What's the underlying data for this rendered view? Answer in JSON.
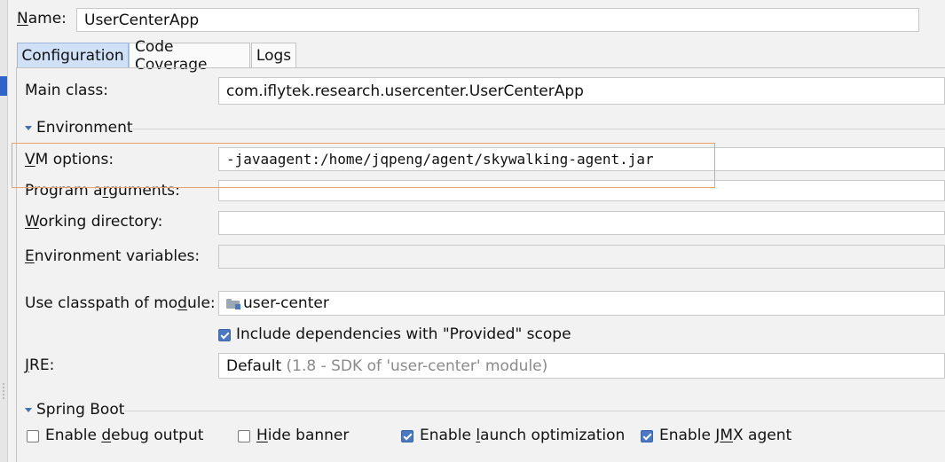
{
  "name": {
    "label_before": "",
    "label_ul": "N",
    "label_after": "ame:",
    "value": "UserCenterApp"
  },
  "tabs": [
    {
      "label": "Configuration",
      "active": true
    },
    {
      "label": "Code Coverage",
      "active": false
    },
    {
      "label": "Logs",
      "active": false
    }
  ],
  "main_class": {
    "label": "Main class:",
    "value": "com.iflytek.research.usercenter.UserCenterApp"
  },
  "environment": {
    "title": "Environment"
  },
  "vm_options": {
    "label_ul": "V",
    "label_after": "M options:",
    "value": "-javaagent:/home/jqpeng/agent/skywalking-agent.jar"
  },
  "program_arguments": {
    "label_before": "Program a",
    "label_ul": "r",
    "label_after": "guments:",
    "value": ""
  },
  "working_directory": {
    "label_ul": "W",
    "label_after": "orking directory:",
    "value": ""
  },
  "environment_variables": {
    "label_ul": "E",
    "label_after": "nvironment variables:",
    "value": ""
  },
  "classpath_module": {
    "label_before": "Use classpath of mo",
    "label_ul": "d",
    "label_after": "ule:",
    "value": "user-center",
    "icon": "module-folder-icon"
  },
  "include_provided": {
    "label": "Include dependencies with \"Provided\" scope",
    "checked": true
  },
  "jre": {
    "label_ul": "J",
    "label_after": "RE:",
    "value": "Default",
    "detail": "(1.8 - SDK of 'user-center' module)"
  },
  "spring_boot": {
    "title": "Spring Boot",
    "options": [
      {
        "before": "Enable ",
        "ul": "d",
        "after": "ebug output",
        "checked": false
      },
      {
        "before": "",
        "ul": "H",
        "after": "ide banner",
        "checked": false
      },
      {
        "before": "Enable ",
        "ul": "l",
        "after": "aunch optimization",
        "checked": true
      },
      {
        "before": "Enable J",
        "ul": "M",
        "after": "X agent",
        "checked": true
      }
    ]
  },
  "colors": {
    "accent": "#4a78c2",
    "highlight_border": "#e8a36c",
    "active_tab": "#cfe0f7"
  }
}
